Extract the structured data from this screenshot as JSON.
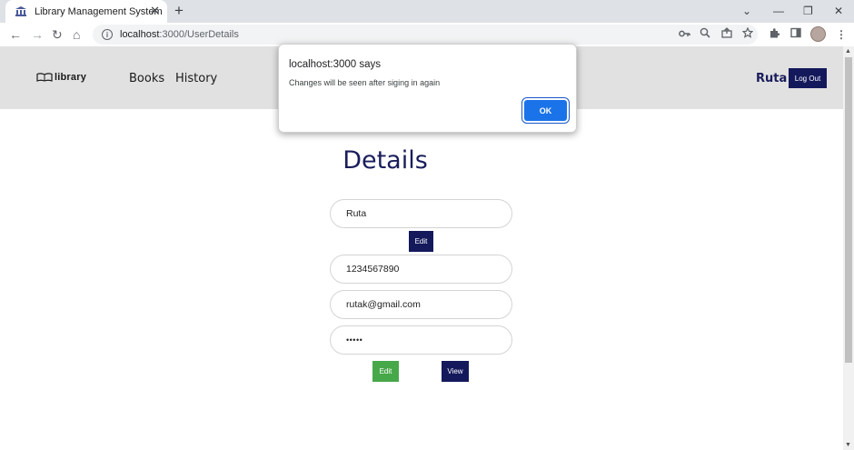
{
  "browser": {
    "tab_title": "Library Management System",
    "tab_close": "✕",
    "new_tab": "+",
    "window_controls": {
      "minimize": "—",
      "restore": "❐",
      "close": "✕",
      "tab_search": "⌄"
    },
    "nav": {
      "back": "←",
      "forward": "→",
      "reload": "↻",
      "home": "⌂"
    },
    "url_host": "localhost",
    "url_path": ":3000/UserDetails",
    "toolbar_icons": [
      "key-icon",
      "zoom-icon",
      "share-icon",
      "star-icon",
      "extensions-icon",
      "side-panel-icon",
      "avatar",
      "menu-icon"
    ]
  },
  "site": {
    "logo_text": "library",
    "nav_items": [
      {
        "label": "Books"
      },
      {
        "label": "History"
      }
    ],
    "user_name": "Ruta",
    "logout_label": "Log Out"
  },
  "details": {
    "title": "Details",
    "name_value": "Ruta",
    "name_edit_label": "Edit",
    "phone_value": "1234567890",
    "email_value": "rutak@gmail.com",
    "password_value": "•••••",
    "edit_label": "Edit",
    "view_label": "View"
  },
  "dialog": {
    "title": "localhost:3000 says",
    "message": "Changes will be seen after siging in again",
    "ok_label": "OK"
  },
  "colors": {
    "navy": "#14195c",
    "green": "#47a84a",
    "accent_blue": "#1a73e8",
    "header_bg": "#e1e1e1"
  }
}
